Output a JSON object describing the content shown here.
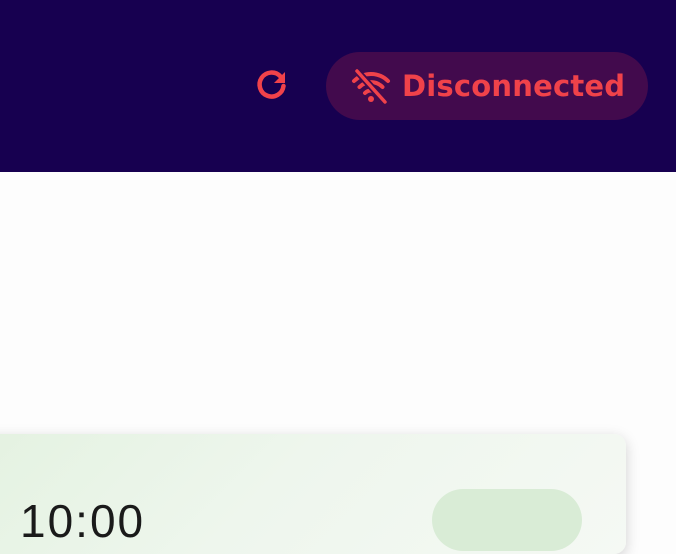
{
  "header": {
    "refresh_icon": "refresh-icon",
    "status": {
      "icon": "wifi-off-icon",
      "label": "Disconnected",
      "color": "#f0424a",
      "pill_background": "#420a4d"
    },
    "background": "#170050"
  },
  "card": {
    "time": "10:00"
  }
}
